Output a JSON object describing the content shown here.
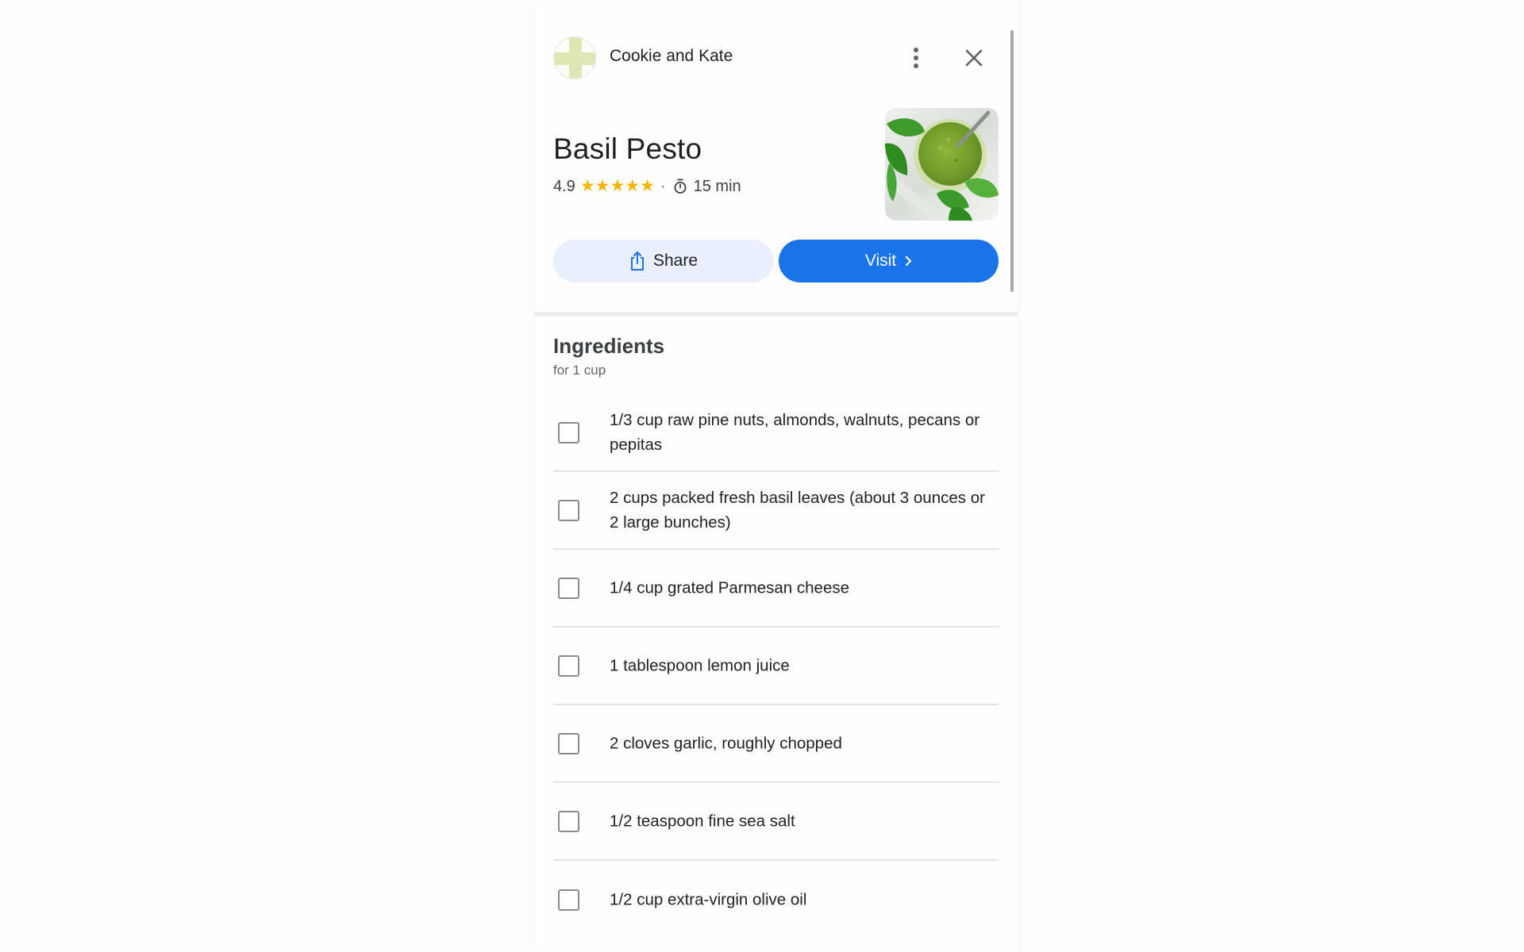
{
  "header": {
    "site_name": "Cookie and Kate",
    "more_icon": "more-vert-icon",
    "close_icon": "close-icon"
  },
  "recipe": {
    "title": "Basil Pesto",
    "rating": "4.9",
    "rating_value": 4.9,
    "rating_max": 5,
    "stars": [
      "★",
      "★",
      "★",
      "★",
      "★"
    ],
    "separator": "·",
    "time": "15 min",
    "timer_icon": "timer-icon",
    "image_alt": "Basil pesto in a glass jar with basil leaves"
  },
  "actions": {
    "share_label": "Share",
    "visit_label": "Visit",
    "share_icon": "share-icon",
    "visit_icon": "chevron-right-icon"
  },
  "ingredients": {
    "title": "Ingredients",
    "yield": "for 1 cup",
    "items": [
      {
        "text": "1/3 cup raw pine nuts, almonds, walnuts, pecans or pepitas",
        "checked": false
      },
      {
        "text": "2 cups packed fresh basil leaves (about 3 ounces or 2 large bunches)",
        "checked": false
      },
      {
        "text": "1/4 cup grated Parmesan cheese",
        "checked": false
      },
      {
        "text": "1 tablespoon lemon juice",
        "checked": false
      },
      {
        "text": "2 cloves garlic, roughly chopped",
        "checked": false
      },
      {
        "text": "1/2 teaspoon fine sea salt",
        "checked": false
      },
      {
        "text": "1/2 cup extra-virgin olive oil",
        "checked": false
      }
    ]
  },
  "colors": {
    "accent": "#1a73e8",
    "share_bg": "#e9f0fc",
    "star": "#f5b400",
    "logo_cross": "#dfe6b6"
  }
}
